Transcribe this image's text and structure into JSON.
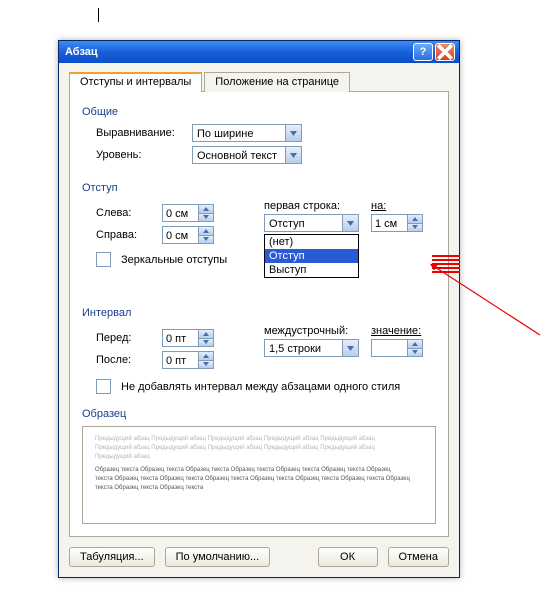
{
  "window": {
    "title": "Абзац"
  },
  "tabs": {
    "t1": "Отступы и интервалы",
    "t2": "Положение на странице"
  },
  "groups": {
    "general": "Общие",
    "indent": "Отступ",
    "interval": "Интервал",
    "sample": "Образец"
  },
  "general": {
    "align_label": "Выравнивание:",
    "align_value": "По ширине",
    "level_label": "Уровень:",
    "level_value": "Основной текст"
  },
  "indent": {
    "left_label": "Слева:",
    "left_value": "0 см",
    "right_label": "Справа:",
    "right_value": "0 см",
    "mirror_label": "Зеркальные отступы",
    "firstline_label": "первая строка:",
    "firstline_value": "Отступ",
    "firstline_options": {
      "o0": "(нет)",
      "o1": "Отступ",
      "o2": "Выступ"
    },
    "by_label": "на:",
    "by_value": "1 см"
  },
  "interval": {
    "before_label": "Перед:",
    "before_value": "0 пт",
    "after_label": "После:",
    "after_value": "0 пт",
    "line_label": "междустрочный:",
    "line_value": "1,5 строки",
    "val_label": "значение:",
    "val_value": "",
    "nospace_label": "Не добавлять интервал между абзацами одного стиля"
  },
  "preview": {
    "line1": "Предыдущий абзац Предыдущий абзац Предыдущий абзац Предыдущий абзац Предыдущий абзац",
    "line2": "Предыдущий абзац Предыдущий абзац Предыдущий абзац Предыдущий абзац Предыдущий абзац",
    "line3": "Предыдущий абзац",
    "dark1": "Образец текста Образец текста Образец текста Образец текста Образец текста Образец текста Образец",
    "dark2": "текста Образец текста Образец текста Образец текста Образец текста Образец текста Образец текста Образец",
    "dark3": "текста Образец текста Образец текста"
  },
  "buttons": {
    "tabs": "Табуляция...",
    "default": "По умолчанию...",
    "ok": "ОК",
    "cancel": "Отмена"
  }
}
